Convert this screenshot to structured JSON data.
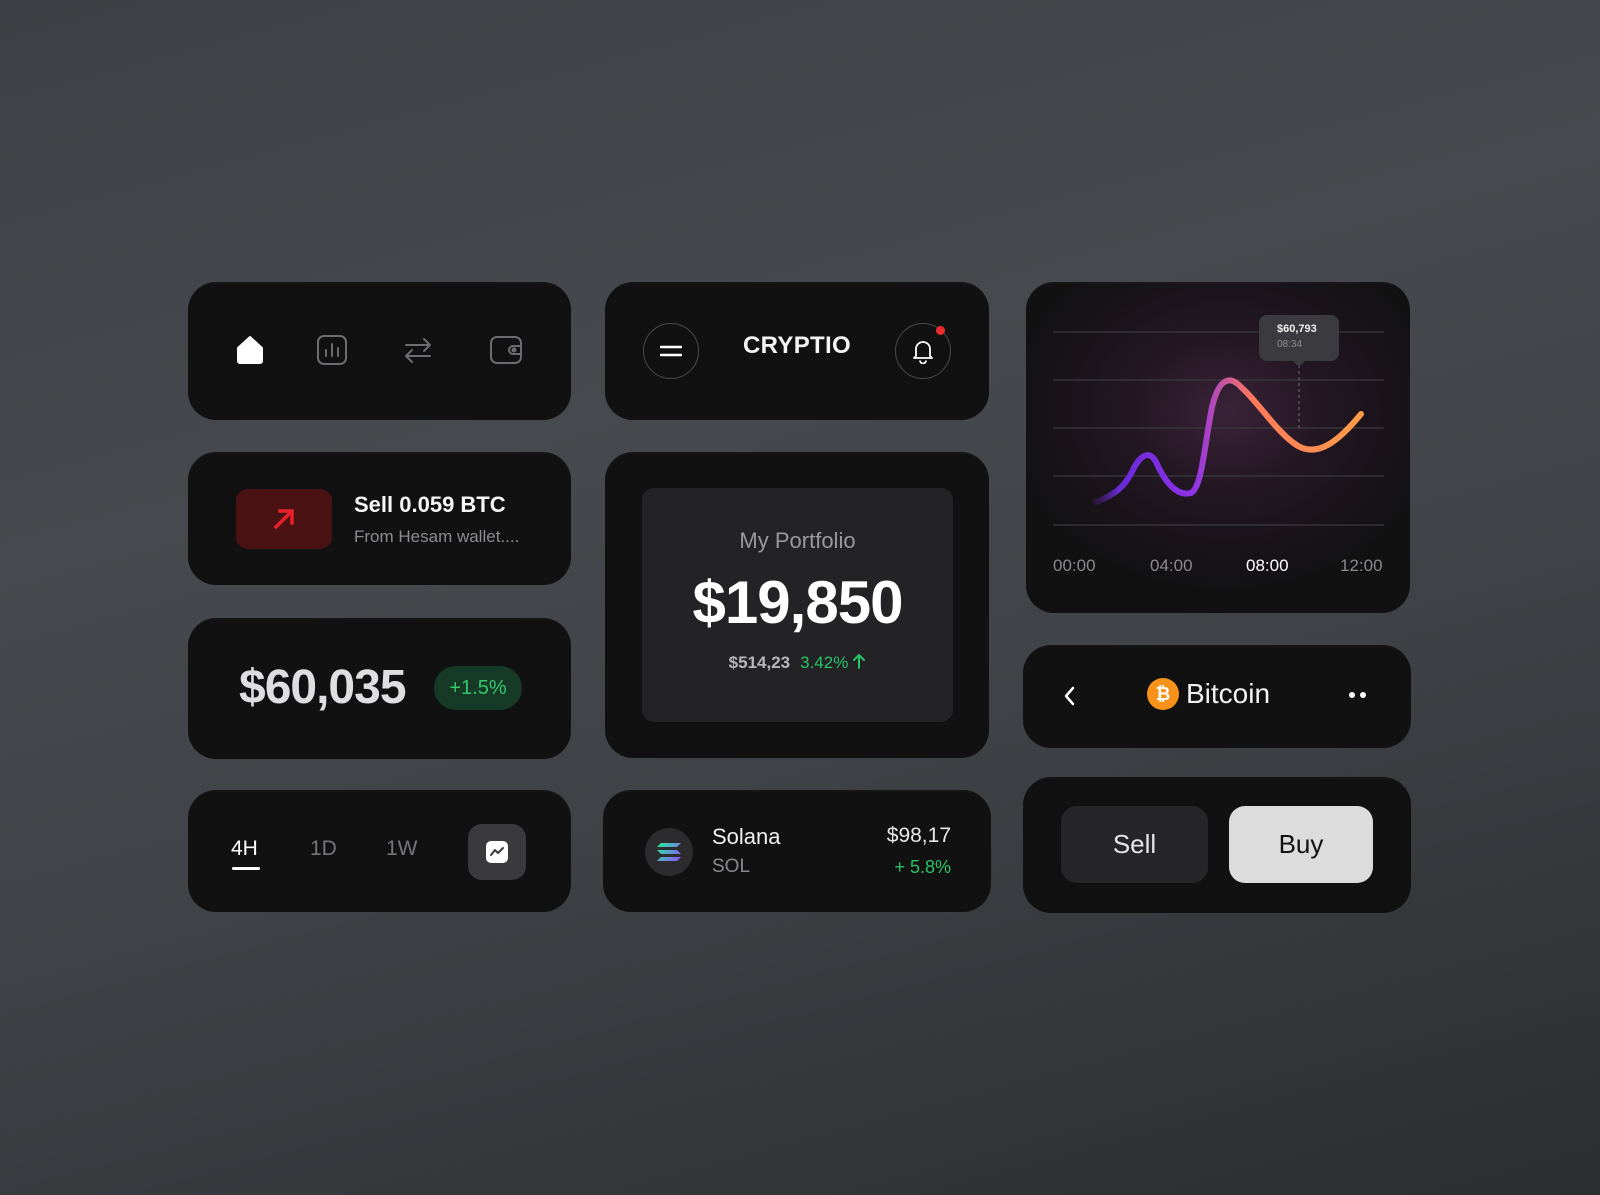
{
  "nav": {
    "items": [
      {
        "icon": "home-icon",
        "active": true
      },
      {
        "icon": "bar-chart-icon",
        "active": false
      },
      {
        "icon": "transfer-icon",
        "active": false
      },
      {
        "icon": "wallet-icon",
        "active": false
      }
    ]
  },
  "header": {
    "brand": "CRYPTIO",
    "menu_icon": "menu-icon",
    "bell_icon": "bell-icon",
    "has_notification": true
  },
  "price_chart": {
    "tooltip_value": "$60,793",
    "tooltip_time": "08:34",
    "x_ticks": [
      "00:00",
      "04:00",
      "08:00",
      "12:00"
    ],
    "active_tick": "08:00",
    "gradient_colors": [
      "#7b2ff7",
      "#ff8a4c"
    ]
  },
  "transaction": {
    "title": "Sell 0.059 BTC",
    "subtitle": "From Hesam wallet....",
    "icon": "arrow-up-right-icon",
    "icon_color": "#e8202a"
  },
  "portfolio": {
    "label": "My Portfolio",
    "value": "$19,850",
    "change_amount": "$514,23",
    "change_percent": "3.42%"
  },
  "ticker": {
    "price": "$60,035",
    "change": "+1.5%"
  },
  "coin_header": {
    "name": "Bitcoin",
    "symbol_glyph": "₿",
    "brand_color": "#f7931a"
  },
  "range": {
    "tabs": [
      "4H",
      "1D",
      "1W"
    ],
    "active": "4H",
    "toggle_icon": "line-chart-icon"
  },
  "asset": {
    "name": "Solana",
    "symbol": "SOL",
    "price": "$98,17",
    "change": "+ 5.8%"
  },
  "trade": {
    "sell_label": "Sell",
    "buy_label": "Buy"
  }
}
